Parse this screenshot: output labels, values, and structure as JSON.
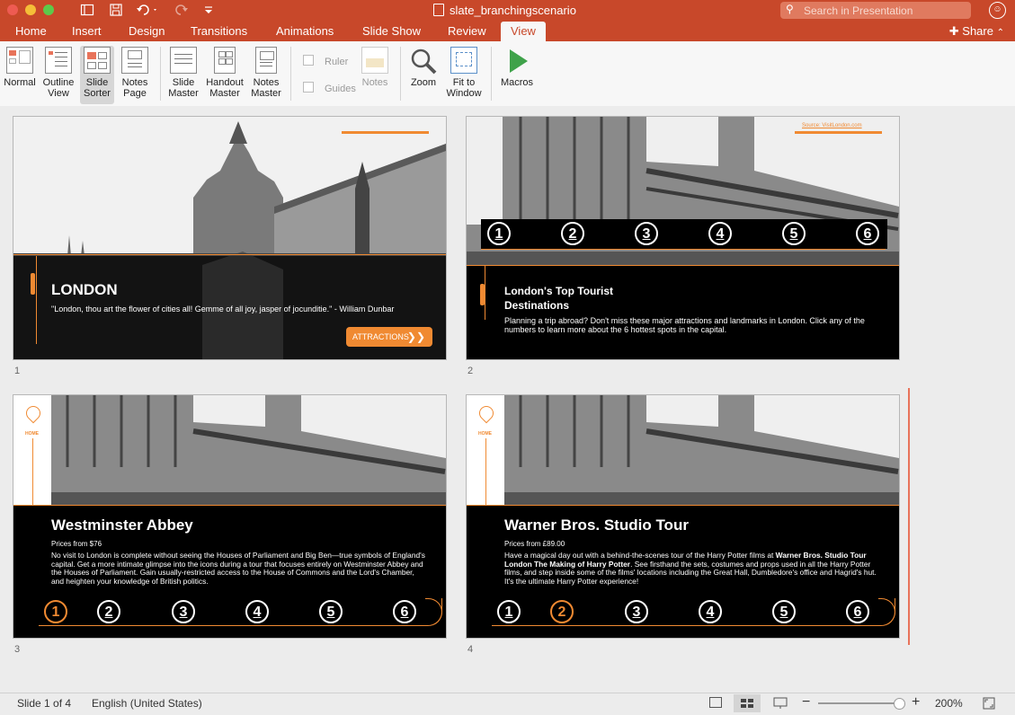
{
  "window": {
    "doc_title": "slate_branchingscenario",
    "search_placeholder": "Search in Presentation"
  },
  "tabs": [
    "Home",
    "Insert",
    "Design",
    "Transitions",
    "Animations",
    "Slide Show",
    "Review",
    "View"
  ],
  "active_tab": "View",
  "share_label": "Share",
  "ribbon": {
    "normal": "Normal",
    "outline_view": [
      "Outline",
      "View"
    ],
    "slide_sorter": [
      "Slide",
      "Sorter"
    ],
    "notes_page": [
      "Notes",
      "Page"
    ],
    "slide_master": [
      "Slide",
      "Master"
    ],
    "handout_master": [
      "Handout",
      "Master"
    ],
    "notes_master": [
      "Notes",
      "Master"
    ],
    "ruler": "Ruler",
    "guides": "Guides",
    "notes": "Notes",
    "zoom": "Zoom",
    "fit_to_window": [
      "Fit to",
      "Window"
    ],
    "macros": "Macros"
  },
  "slides": {
    "s1": {
      "number": "1",
      "title": "LONDON",
      "quote": "\"London, thou art the flower of cities all! Gemme of all joy, jasper of jocunditie.\" - William Dunbar",
      "button": "ATTRACTIONS",
      "button_arrows": "❯❯"
    },
    "s2": {
      "number": "2",
      "source": "Source: VisitLondon.com",
      "numbers": [
        "1",
        "2",
        "3",
        "4",
        "5",
        "6"
      ],
      "title_line1": "London's Top Tourist",
      "title_line2": "Destinations",
      "body": "Planning a trip abroad? Don't miss these major attractions and landmarks in London. Click any of the numbers to learn more about the 6 hottest spots in the capital."
    },
    "s3": {
      "number": "3",
      "home": "HOME",
      "title": "Westminster Abbey",
      "price": "Prices from $76",
      "body": "No visit to London is complete without seeing the Houses of Parliament and Big Ben—true symbols of England's capital. Get a more intimate glimpse into the icons during a tour that focuses entirely on Westminster Abbey and the Houses of Parliament. Gain usually-restricted access to the House of Commons and the Lord's Chamber, and heighten your knowledge of British politics.",
      "numbers": [
        "1",
        "2",
        "3",
        "4",
        "5",
        "6"
      ],
      "selected": 1
    },
    "s4": {
      "number": "4",
      "home": "HOME",
      "title": "Warner Bros. Studio Tour",
      "price": "Prices from £89.00",
      "body_pre": "Have a magical day out with a behind-the-scenes tour of the Harry Potter films at ",
      "body_bold": "Warner Bros. Studio Tour London The Making of Harry Potter",
      "body_post": ". See firsthand the sets, costumes and props used in all the Harry Potter films, and step inside some of the films' locations including the Great Hall, Dumbledore's office and Hagrid's hut. It's the ultimate Harry Potter experience!",
      "numbers": [
        "1",
        "2",
        "3",
        "4",
        "5",
        "6"
      ],
      "selected": 2
    }
  },
  "status": {
    "slide_info": "Slide 1 of 4",
    "language": "English (United States)",
    "zoom": "200%"
  },
  "colors": {
    "accent": "#c8482a",
    "slide_orange": "#f08a32"
  }
}
